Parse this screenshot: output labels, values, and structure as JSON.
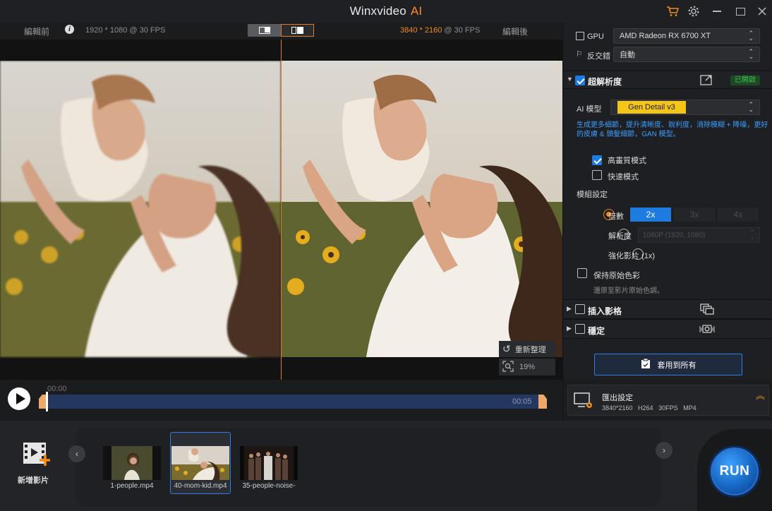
{
  "app": {
    "title": "Winxvideo",
    "title_ai": "AI"
  },
  "titlebar": {
    "cart_icon": "cart-icon",
    "settings_icon": "gear-icon"
  },
  "preview": {
    "before_label": "編輯前",
    "before_res": "1920 * 1080 @ 30 FPS",
    "after_res_highlight": "3840 * 2160",
    "after_res_suffix": " @ 30 FPS",
    "after_label": "編輯後",
    "reset_label": "重新整理",
    "zoom_value": "19%"
  },
  "timeline": {
    "start_time": "00:00",
    "end_time": "00:05"
  },
  "files": {
    "add_label": "新增影片",
    "items": [
      {
        "name": "1-people.mp4"
      },
      {
        "name": "40-mom-kid.mp4"
      },
      {
        "name": "35-people-noise-"
      }
    ]
  },
  "panel": {
    "gpu_label": "GPU",
    "gpu_value": "AMD Radeon RX 6700 XT",
    "deint_label": "反交錯",
    "deint_value": "自動",
    "sr_title": "超解析度",
    "sr_status": "已開啟",
    "model_label": "AI 模型",
    "model_value": "Gen Detail v3",
    "model_desc": "生成更多細節，提升清晰度、銳利度，消除模糊 + 降噪，更好的皮膚 & 頭髮細節，GAN 模型。",
    "hq_label": "高畫質模式",
    "fast_label": "快速模式",
    "module_label": "模組設定",
    "scale_label": "倍數",
    "scale_options": [
      "2x",
      "3x",
      "4x"
    ],
    "res_label": "解析度",
    "res_value": "1080P (1920, 1080)",
    "enhance_label": "強化影片 (1x)",
    "keep_color_label": "保持原始色彩",
    "keep_color_desc": "還原至影片原始色調。",
    "interp_title": "插入影格",
    "stab_title": "穩定",
    "apply_all": "套用到所有",
    "export_title": "匯出設定",
    "export_specs": "3840*2160   H264   30FPS   MP4"
  },
  "run_label": "RUN",
  "colors": {
    "accent": "#f08c1a",
    "blue": "#1e7be0",
    "run": "#1565c0",
    "status_green": "#3fbf4f",
    "model_yellow": "#f5c518"
  }
}
